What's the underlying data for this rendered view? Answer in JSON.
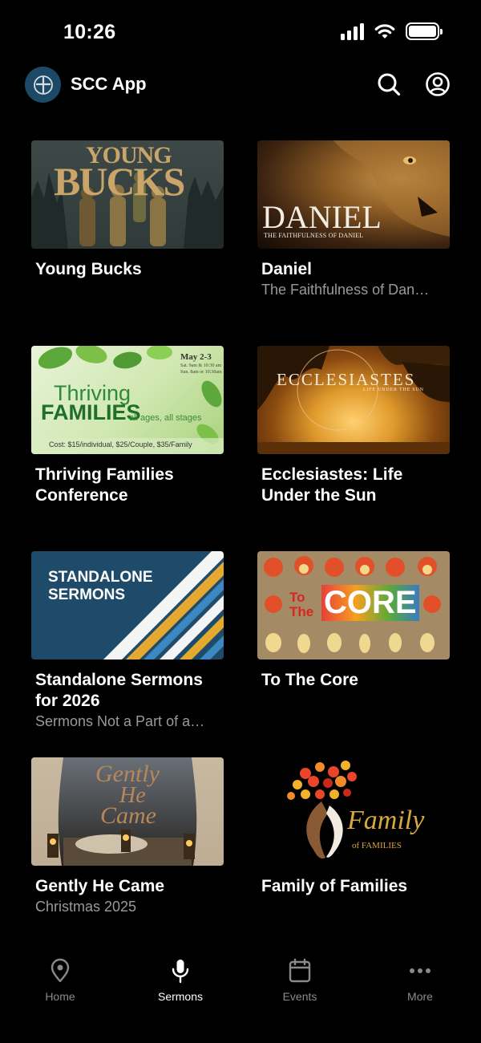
{
  "status": {
    "time": "10:26"
  },
  "header": {
    "title": "SCC App"
  },
  "icons": {
    "logo": "cross-circle-icon",
    "search": "search-icon",
    "profile": "profile-icon"
  },
  "sermons": [
    {
      "title": "Young Bucks",
      "subtitle": "",
      "art": {
        "line1": "YOUNG",
        "line2": "BUCKS"
      }
    },
    {
      "title": "Daniel",
      "subtitle": "The Faithfulness of Dan…",
      "art": {
        "line1": "DANIEL",
        "line2": "THE FAITHFULNESS OF DANIEL"
      }
    },
    {
      "title": "Thriving Families Conference",
      "subtitle": "",
      "art": {
        "line1": "Thriving",
        "line2": "FAMILIES",
        "line3": "all ages, all stages",
        "date": "May 2-3",
        "times1": "Sat. 9am & 10:30 am",
        "times2": "Sun. 8am or 10:30am",
        "cost": "Cost: $15/individual, $25/Couple, $35/Family"
      }
    },
    {
      "title": "Ecclesiastes: Life Under the Sun",
      "subtitle": "",
      "art": {
        "line1": "ECCLESIASTES",
        "line2": "LIFE UNDER THE SUN"
      }
    },
    {
      "title": "Standalone Sermons for 2026",
      "subtitle": "Sermons Not a Part of a…",
      "art": {
        "line1": "STANDALONE",
        "line2": "SERMONS"
      }
    },
    {
      "title": "To The Core",
      "subtitle": "",
      "art": {
        "line1": "To",
        "line2": "The",
        "line3": "CORE"
      }
    },
    {
      "title": "Gently He Came",
      "subtitle": "Christmas 2025",
      "art": {
        "line1": "Gently",
        "line2": "He",
        "line3": "Came"
      }
    },
    {
      "title": "Family of Families",
      "subtitle": "",
      "art": {
        "line1": "Family",
        "line2": "of FAMILIES"
      }
    }
  ],
  "tabs": [
    {
      "label": "Home",
      "icon": "location-pin-icon",
      "active": false
    },
    {
      "label": "Sermons",
      "icon": "microphone-icon",
      "active": true
    },
    {
      "label": "Events",
      "icon": "calendar-icon",
      "active": false
    },
    {
      "label": "More",
      "icon": "more-dots-icon",
      "active": false
    }
  ],
  "colors": {
    "background": "#000000",
    "subtitle": "#9a9a9a",
    "tab_inactive": "#8a8a8a",
    "accent_logo": "#1c4a66"
  }
}
